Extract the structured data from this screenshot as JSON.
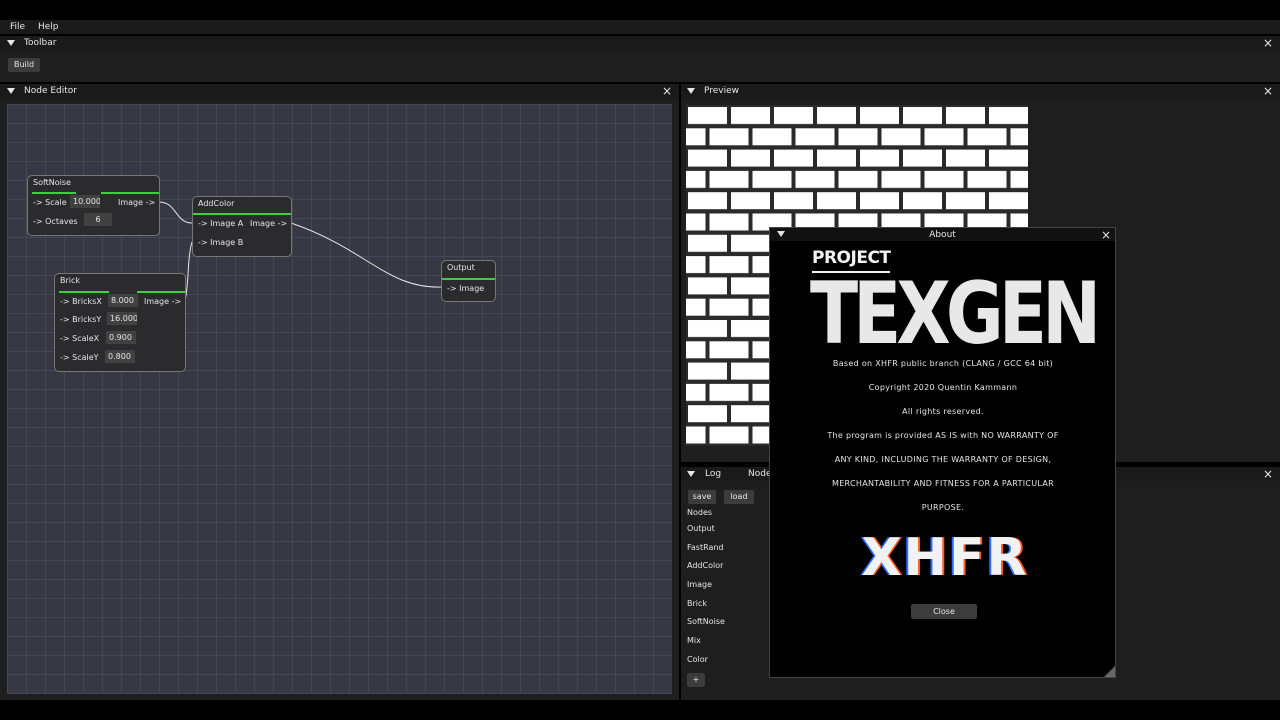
{
  "menubar": {
    "items": [
      "File",
      "Help"
    ]
  },
  "toolbar": {
    "title": "Toolbar",
    "build_label": "Build"
  },
  "node_editor": {
    "title": "Node Editor",
    "nodes": {
      "softnoise": {
        "title": "SoftNoise",
        "output": "Image ->",
        "rows": [
          {
            "label": "-> Scale",
            "value": "10.000"
          },
          {
            "label": "-> Octaves",
            "value": "6"
          }
        ]
      },
      "addcolor": {
        "title": "AddColor",
        "input_a": "-> Image A",
        "input_b": "-> Image B",
        "output": "Image ->"
      },
      "brick": {
        "title": "Brick",
        "output": "Image ->",
        "rows": [
          {
            "label": "-> BricksX",
            "value": "8.000"
          },
          {
            "label": "-> BricksY",
            "value": "16.000"
          },
          {
            "label": "-> ScaleX",
            "value": "0.900"
          },
          {
            "label": "-> ScaleY",
            "value": "0.800"
          }
        ]
      },
      "output": {
        "title": "Output",
        "input": "-> Image"
      }
    }
  },
  "preview": {
    "title": "Preview"
  },
  "log_panel": {
    "tabs": [
      "Log",
      "Node"
    ],
    "save_label": "save",
    "load_label": "load",
    "section_label": "Nodes",
    "items": [
      "Output",
      "FastRand",
      "AddColor",
      "Image",
      "Brick",
      "SoftNoise",
      "Mix",
      "Color"
    ],
    "add_label": "+"
  },
  "about": {
    "title": "About",
    "logo_top": "PROJECT",
    "logo_main": "TEXGEN",
    "lines": [
      "Based on XHFR public branch (CLANG / GCC 64 bit)",
      "Copyright 2020 Quentin Kammann",
      "All rights reserved.",
      "The program is provided AS IS with NO WARRANTY OF",
      "ANY KIND, INCLUDING THE WARRANTY OF DESIGN,",
      "MERCHANTABILITY AND FITNESS FOR A PARTICULAR",
      "PURPOSE."
    ],
    "brand_logo": "XHFR",
    "close_label": "Close"
  },
  "colors": {
    "accent_green": "#3cd040",
    "grid_bg": "#363843",
    "panel_bg": "#1e1e1e"
  }
}
